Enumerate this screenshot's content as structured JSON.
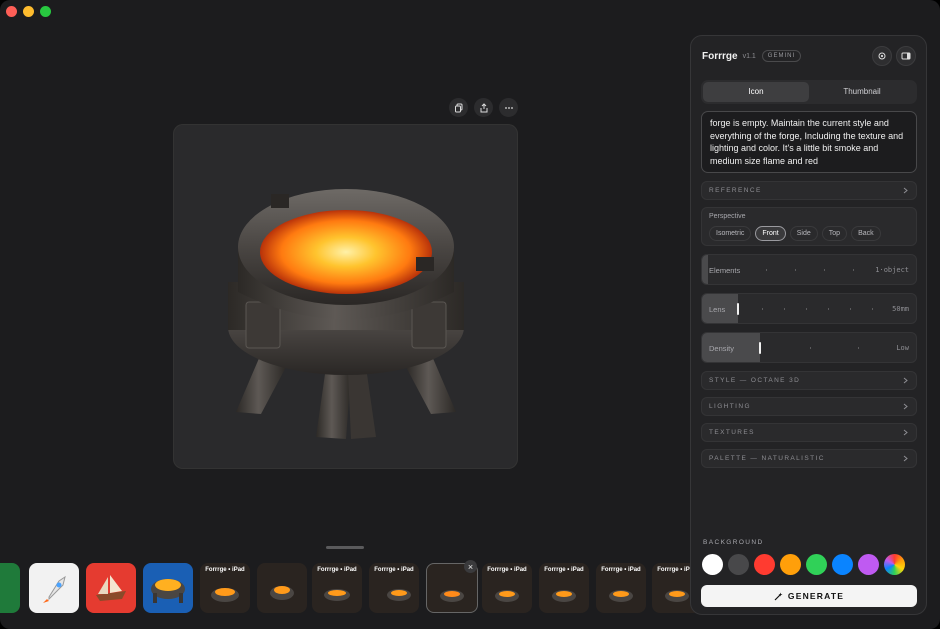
{
  "panel": {
    "app_name": "Forrrge",
    "version": "v1.1",
    "model_badge": "GEMINI",
    "tabs": [
      {
        "label": "Icon",
        "active": true
      },
      {
        "label": "Thumbnail",
        "active": false
      }
    ],
    "prompt_text": "forge is empty. Maintain the current style and everything of the forge, Including the texture and lighting and color. It's a little bit smoke and medium size flame and red",
    "reference_label": "REFERENCE",
    "perspective": {
      "title": "Perspective",
      "options": [
        "Isometric",
        "Front",
        "Side",
        "Top",
        "Back"
      ],
      "selected": "Front"
    },
    "sliders": {
      "elements": {
        "label": "Elements",
        "value": "1·object",
        "level": 0.03
      },
      "lens": {
        "label": "Lens",
        "value": "50mm",
        "level": 0.17
      },
      "density": {
        "label": "Density",
        "value": "Low",
        "level": 0.27
      }
    },
    "sections": {
      "style": "STYLE — OCTANE 3D",
      "lighting": "LIGHTING",
      "textures": "TEXTURES",
      "palette": "PALETTE — NATURALISTIC"
    },
    "background": {
      "title": "BACKGROUND",
      "colors": [
        "#ffffff",
        "#48484a",
        "#ff3b30",
        "#ff9f0a",
        "#30d158",
        "#0a84ff",
        "#bf5af2",
        "rainbow"
      ]
    },
    "generate_label": "GENERATE"
  },
  "thumbnails": {
    "ipad_label": "Forrrge • iPad"
  },
  "colors": {
    "accent": "#f4f4f4",
    "lava": "#ff8c1a"
  }
}
